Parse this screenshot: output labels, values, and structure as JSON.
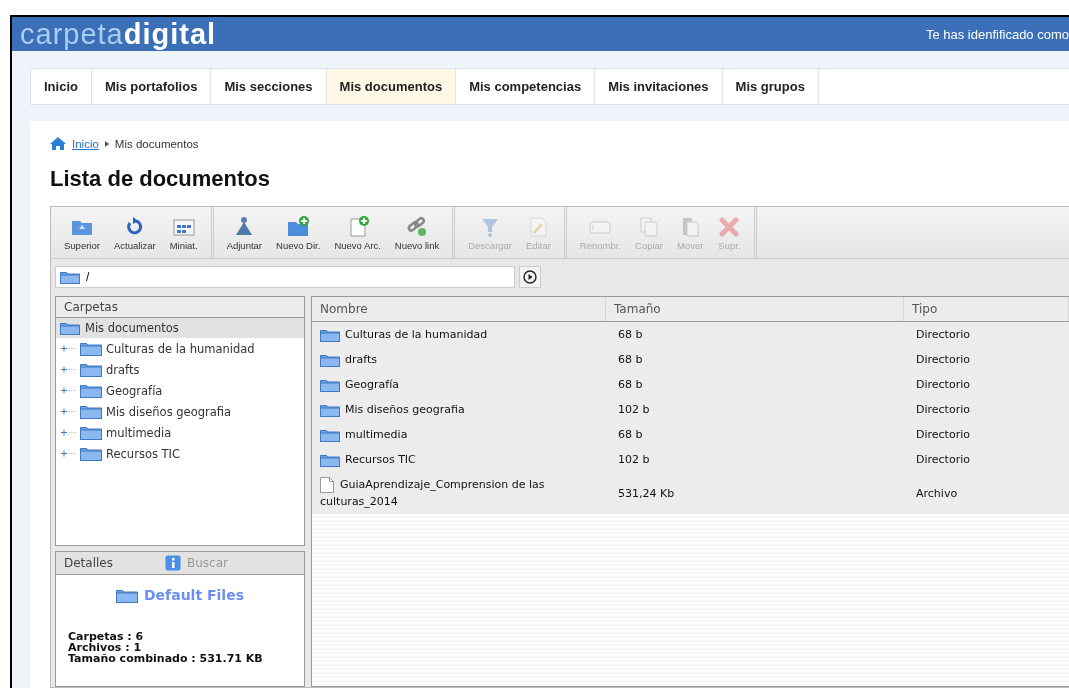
{
  "header": {
    "logo": "carpeta**digital**",
    "user_text": "Te has idenfificado como"
  },
  "nav": [
    {
      "label": "Inicio",
      "selected": false
    },
    {
      "label": "Mis portafolios",
      "selected": false
    },
    {
      "label": "Mis secciones",
      "selected": false
    },
    {
      "label": "Mis documentos",
      "selected": true
    },
    {
      "label": "Mis competencias",
      "selected": false
    },
    {
      "label": "Mis invitaciones",
      "selected": false
    },
    {
      "label": "Mis grupos",
      "selected": false
    }
  ],
  "breadcrumb": {
    "link": "Inicio",
    "current": "Mis documentos"
  },
  "page_title": "Lista de documentos",
  "toolbar": [
    [
      {
        "label": "Superior",
        "kind": "up",
        "disabled": false
      },
      {
        "label": "Actualizar",
        "kind": "refresh",
        "disabled": false
      },
      {
        "label": "Miniat.",
        "kind": "thumbs",
        "disabled": false
      }
    ],
    [
      {
        "label": "Adjuntar",
        "kind": "attach",
        "disabled": false
      },
      {
        "label": "Nuevo Dir.",
        "kind": "newdir",
        "disabled": false
      },
      {
        "label": "Nuevo Arc.",
        "kind": "newfile",
        "disabled": false
      },
      {
        "label": "Nuevo link",
        "kind": "link",
        "disabled": false
      }
    ],
    [
      {
        "label": "Descargar",
        "kind": "download",
        "disabled": true
      },
      {
        "label": "Editar",
        "kind": "edit",
        "disabled": true
      }
    ],
    [
      {
        "label": "Renombr.",
        "kind": "rename",
        "disabled": true
      },
      {
        "label": "Copiar",
        "kind": "copy",
        "disabled": true
      },
      {
        "label": "Mover",
        "kind": "move",
        "disabled": true
      },
      {
        "label": "Supr.",
        "kind": "delete",
        "disabled": true
      }
    ]
  ],
  "path": {
    "value": "/"
  },
  "folders_panel": {
    "title": "Carpetas",
    "tree": [
      {
        "label": "Mis documentos",
        "selected": true,
        "children": [
          {
            "label": "Culturas de la humanidad",
            "selected": false,
            "expanded": false
          },
          {
            "label": "drafts",
            "selected": false,
            "expanded": false
          },
          {
            "label": "Geografía",
            "selected": false,
            "expanded": false
          },
          {
            "label": "Mis diseños geografia",
            "selected": false,
            "expanded": false
          },
          {
            "label": "multimedia",
            "selected": false,
            "expanded": false
          },
          {
            "label": "Recursos TIC",
            "selected": false,
            "expanded": false
          }
        ]
      }
    ]
  },
  "table": {
    "columns": [
      "Nombre",
      "Tamaño",
      "Tipo"
    ],
    "rows": [
      {
        "kind": "folder",
        "name": "Culturas de la humanidad",
        "size": "68 b",
        "type": "Directorio"
      },
      {
        "kind": "folder",
        "name": "drafts",
        "size": "68 b",
        "type": "Directorio"
      },
      {
        "kind": "folder",
        "name": "Geografía",
        "size": "68 b",
        "type": "Directorio"
      },
      {
        "kind": "folder",
        "name": "Mis diseños geografia",
        "size": "102 b",
        "type": "Directorio"
      },
      {
        "kind": "folder",
        "name": "multimedia",
        "size": "68 b",
        "type": "Directorio"
      },
      {
        "kind": "folder",
        "name": "Recursos TIC",
        "size": "102 b",
        "type": "Directorio"
      },
      {
        "kind": "file",
        "name": "GuiaAprendizaje_Comprension de las culturas_2014",
        "size": "531,24 Kb",
        "type": "Archivo"
      }
    ]
  },
  "details_panel": {
    "tabs": [
      {
        "label": "Detalles",
        "selected": true
      },
      {
        "label": "Buscar",
        "selected": false
      }
    ],
    "title": "Default Files",
    "lines": [
      "Carpetas : 6",
      "Archivos : 1",
      "Tamaño combinado : 531.71 KB"
    ]
  }
}
